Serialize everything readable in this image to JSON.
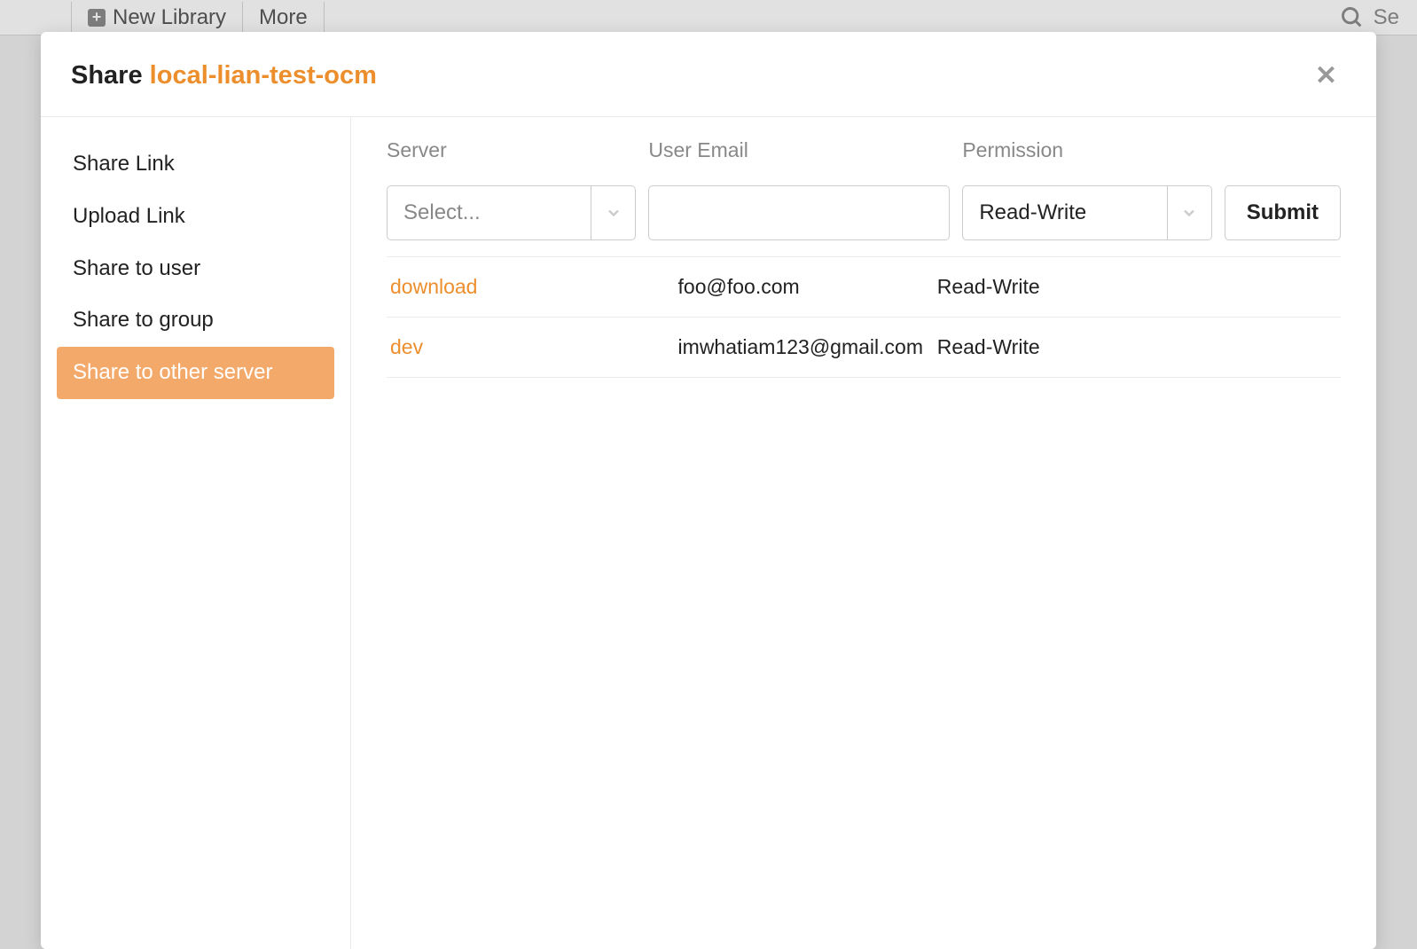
{
  "background": {
    "new_library": "New Library",
    "more": "More",
    "search_placeholder": "Se"
  },
  "modal": {
    "title_prefix": "Share ",
    "title_name": "local-lian-test-ocm"
  },
  "sidebar": {
    "items": [
      {
        "label": "Share Link",
        "active": false
      },
      {
        "label": "Upload Link",
        "active": false
      },
      {
        "label": "Share to user",
        "active": false
      },
      {
        "label": "Share to group",
        "active": false
      },
      {
        "label": "Share to other server",
        "active": true
      }
    ]
  },
  "form": {
    "server_label": "Server",
    "email_label": "User Email",
    "permission_label": "Permission",
    "server_placeholder": "Select...",
    "email_value": "",
    "permission_value": "Read-Write",
    "submit_label": "Submit"
  },
  "shares": [
    {
      "server": "download",
      "email": "foo@foo.com",
      "permission": "Read-Write"
    },
    {
      "server": "dev",
      "email": "imwhatiam123@gmail.com",
      "permission": "Read-Write"
    }
  ]
}
